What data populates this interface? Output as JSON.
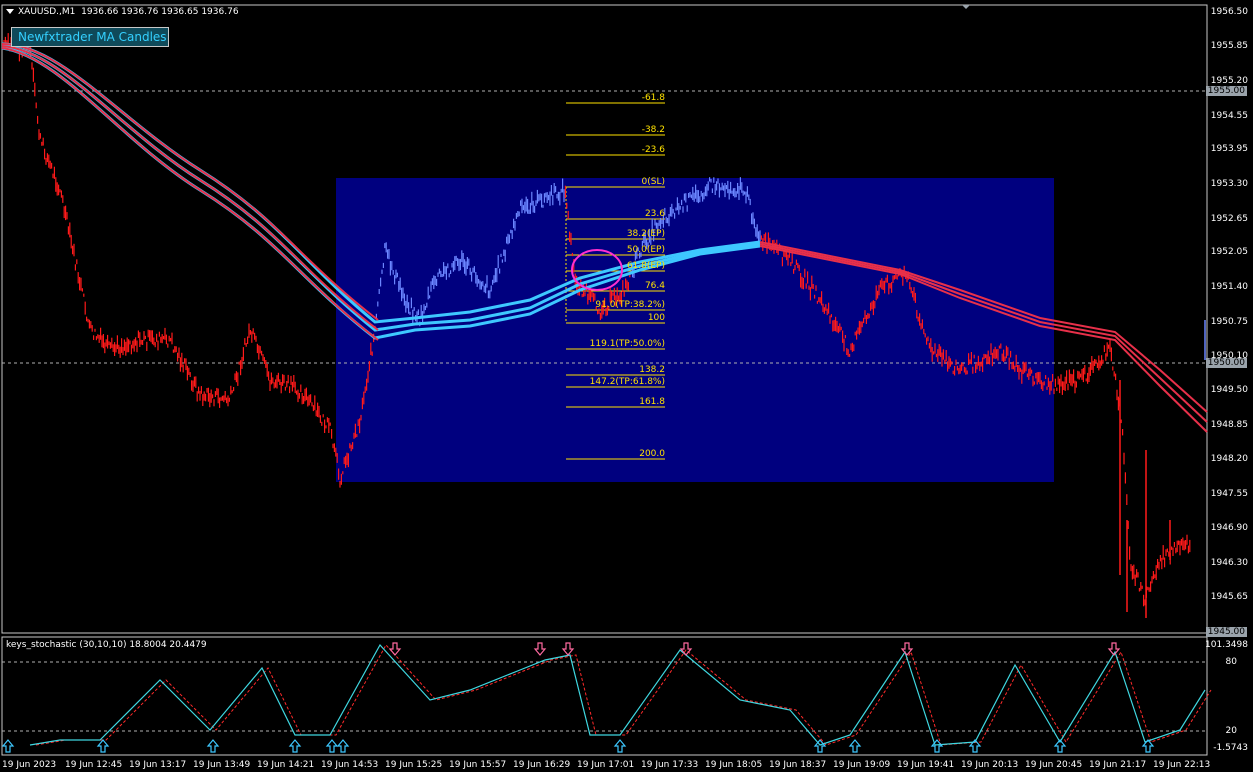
{
  "header": {
    "symbol": "XAUUSD.,M1",
    "ohlc": "1936.66 1936.76 1936.65 1936.76"
  },
  "ma_button": {
    "label": "Newfxtrader MA Candles"
  },
  "indicator": {
    "title": "keys_stochastic (30,10,10) 18.8004 20.4479",
    "levels": [
      "101.3498",
      "80",
      "20",
      "-1.5743"
    ]
  },
  "price_axis": [
    "1956.50",
    "1955.85",
    "1955.20",
    "1954.55",
    "1953.95",
    "1953.30",
    "1952.65",
    "1952.05",
    "1951.40",
    "1950.75",
    "1950.10",
    "1949.50",
    "1948.85",
    "1948.20",
    "1947.55",
    "1946.90",
    "1946.30",
    "1945.65"
  ],
  "price_badges": {
    "top": "1955.00",
    "mid": "1950.00",
    "bottom": "1945.00"
  },
  "time_axis": [
    "19 Jun 2023",
    "19 Jun 12:45",
    "19 Jun 13:17",
    "19 Jun 13:49",
    "19 Jun 14:21",
    "19 Jun 14:53",
    "19 Jun 15:25",
    "19 Jun 15:57",
    "19 Jun 16:29",
    "19 Jun 17:01",
    "19 Jun 17:33",
    "19 Jun 18:05",
    "19 Jun 18:37",
    "19 Jun 19:09",
    "19 Jun 19:41",
    "19 Jun 20:13",
    "19 Jun 20:45",
    "19 Jun 21:17",
    "19 Jun 22:13"
  ],
  "fib_levels": [
    "-61.8",
    "-38.2",
    "-23.6",
    "0(SL)",
    "23.6",
    "38.2(EP)",
    "50.0(EP)",
    "61.8(EP)",
    "76.4",
    "91.0(TP:38.2%)",
    "100",
    "119.1(TP:50.0%)",
    "138.2",
    "147.2(TP:61.8%)",
    "161.8",
    "200.0"
  ],
  "colors": {
    "background": "#000000",
    "zone": "#00007f",
    "bear_candles": "#ff1a1a",
    "bull_candles": "#6b86ff",
    "ma_red": "#e8304a",
    "ma_cyan": "#3ec8ff",
    "fib": "#ffe200",
    "stoch_main": "#3fd7e0",
    "stoch_signal": "#ff2a2a",
    "arrow_up": "#3ec8ff",
    "arrow_down": "#ff6aa0"
  }
}
